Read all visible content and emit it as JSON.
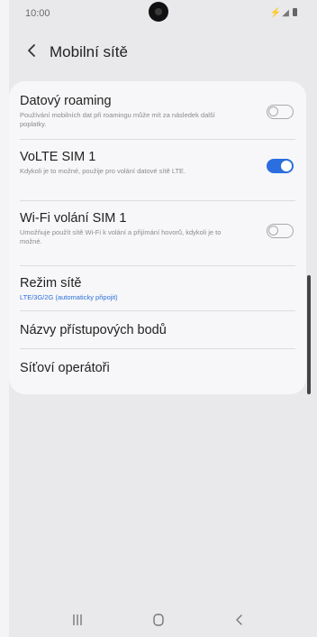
{
  "status_bar": {
    "time": "10:00",
    "icons_text": "⚡◢"
  },
  "header": {
    "title": "Mobilní sítě"
  },
  "settings": [
    {
      "title": "Datový roaming",
      "subtitle": "Používání mobilních dat při roamingu může mít za následek další poplatky.",
      "toggle": "off"
    },
    {
      "title": "VoLTE SIM 1",
      "subtitle": "Kdykoli je to možné, použije pro volání datové sítě LTE.",
      "toggle": "on"
    },
    {
      "title": "Wi-Fi volání SIM 1",
      "subtitle": "Umožňuje použít sítě Wi-Fi k volání a přijímání hovorů, kdykoli je to možné.",
      "toggle": "off"
    },
    {
      "title": "Režim sítě",
      "subtitle": "LTE/3G/2G (automaticky připojit)"
    },
    {
      "title": "Názvy přístupových bodů"
    },
    {
      "title": "Síťoví operátoři"
    }
  ],
  "colors": {
    "accent": "#2a6ee0",
    "background": "#e9e9ec",
    "card": "#f7f7f9"
  },
  "navigation": {
    "recent_icon": "recent-apps-icon",
    "home_icon": "home-icon",
    "back_icon": "back-icon"
  }
}
